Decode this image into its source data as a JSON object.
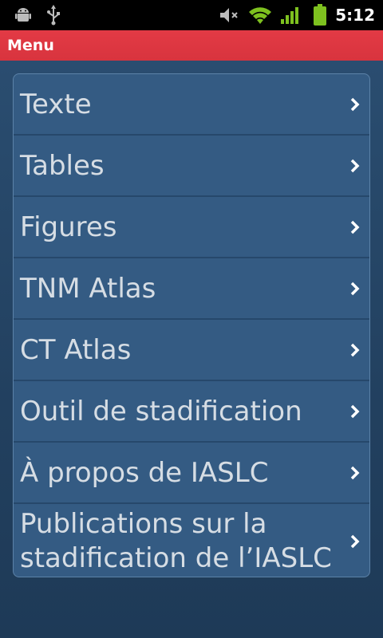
{
  "status_bar": {
    "time": "5:12",
    "icons": [
      "android-debug-icon",
      "usb-icon",
      "mute-icon",
      "wifi-icon",
      "signal-icon",
      "battery-icon"
    ],
    "battery_color": "#7ec11f",
    "signal_color": "#7ec11f",
    "wifi_color": "#7ec11f"
  },
  "title_bar": {
    "title": "Menu",
    "color": "#e03844"
  },
  "menu": {
    "items": [
      {
        "label": "Texte"
      },
      {
        "label": "Tables"
      },
      {
        "label": "Figures"
      },
      {
        "label": "TNM Atlas"
      },
      {
        "label": "CT Atlas"
      },
      {
        "label": "Outil de stadification"
      },
      {
        "label": "À propos de IASLC"
      },
      {
        "label": "Publications sur la stadification de l’IASLC"
      }
    ],
    "chevron_icon": "chevron-right-icon",
    "panel_color": "#345b83"
  }
}
